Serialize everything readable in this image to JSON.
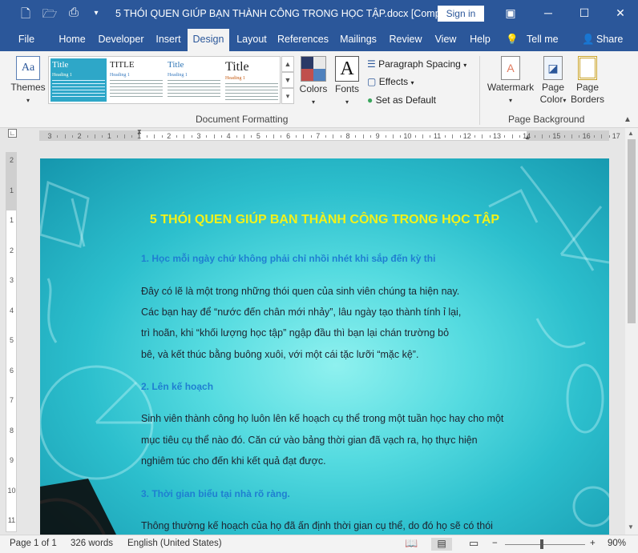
{
  "window": {
    "doc_title": "5 THÓI QUEN GIÚP BẠN THÀNH CÔNG TRONG HỌC TẬP.docx [Comp...",
    "sign_in": "Sign in",
    "qat_icons": [
      "new-document-icon",
      "open-folder-icon",
      "print-preview-icon",
      "customize-qat-icon"
    ]
  },
  "tabs": {
    "file": "File",
    "home": "Home",
    "developer": "Developer",
    "insert": "Insert",
    "design": "Design",
    "layout": "Layout",
    "references": "References",
    "mailings": "Mailings",
    "review": "Review",
    "view": "View",
    "help": "Help",
    "tell_me": "Tell me",
    "share": "Share"
  },
  "ribbon": {
    "themes": "Themes",
    "style_set": {
      "title1": "Title",
      "title2": "TITLE",
      "title3": "Title",
      "title4": "Title",
      "heading": "Heading 1"
    },
    "colors": "Colors",
    "fonts": "Fonts",
    "paragraph_spacing": "Paragraph Spacing",
    "effects": "Effects",
    "set_default": "Set as Default",
    "doc_formatting": "Document Formatting",
    "watermark": "Watermark",
    "page_color": "Page",
    "page_color2": "Color",
    "page_borders": "Page",
    "page_borders2": "Borders",
    "page_background": "Page Background"
  },
  "document": {
    "title": "5 THÓI QUEN GIÚP BẠN THÀNH CÔNG TRONG HỌC TẬP",
    "h1": "1. Học mỗi ngày chứ không phải chỉ nhồi nhét khi sắp đến kỳ thi",
    "p1": [
      "Đây có lẽ là một trong những thói quen của sinh viên chúng ta hiện nay.",
      "Các bạn hay để “nước đến chân mới nhảy”, lâu ngày tạo thành tính ỉ lại,",
      "trì hoãn, khi “khối lượng học tập” ngập đầu thì bạn lại chán trường bỏ",
      "bê, và kết thúc bằng buông xuôi, với một cái tặc lưỡi “mặc kệ”."
    ],
    "h2": "2. Lên kế hoạch",
    "p2": [
      "Sinh viên thành công họ luôn lên kế hoạch cụ thể trong một tuần học hay cho một",
      "mục tiêu cụ thể nào đó. Căn cứ vào bảng thời gian đã vạch ra, họ thực hiện",
      "nghiêm túc cho đến khi kết quả đạt được."
    ],
    "h3": "3. Thời gian biểu tại nhà rõ ràng.",
    "p3": "Thông thường kế hoạch của họ đã ấn định thời gian cụ thể, do đó họ sẽ có thói"
  },
  "ruler": {
    "h_labels": [
      "3",
      "2",
      "1",
      "1",
      "2",
      "3",
      "4",
      "5",
      "6",
      "7",
      "8",
      "9",
      "10",
      "11",
      "12",
      "13",
      "14",
      "15",
      "16",
      "17"
    ],
    "v_labels": [
      "2",
      "1",
      "1",
      "2",
      "3",
      "4",
      "5",
      "6",
      "7",
      "8",
      "9",
      "10",
      "11"
    ]
  },
  "status": {
    "page": "Page 1 of 1",
    "words": "326 words",
    "language": "English (United States)",
    "zoom": "90%"
  }
}
